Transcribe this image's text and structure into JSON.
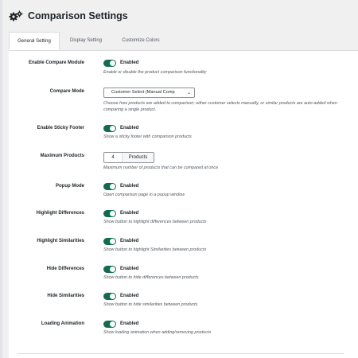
{
  "header": {
    "title": "Comparison Settings",
    "icon": "gears-icon"
  },
  "tabs": [
    {
      "label": "General Setting",
      "active": true
    },
    {
      "label": "Display Setting",
      "active": false
    },
    {
      "label": "Customize Colors",
      "active": false
    }
  ],
  "colors": {
    "toggle_on": "#0f6d4b",
    "page_bg": "#f0f0f1",
    "card_bg": "#ffffff"
  },
  "settings": {
    "compare_module": {
      "label": "Enable Compare Module",
      "state": "Enabled",
      "desc": "Enable or disable the product comparison functionality"
    },
    "compare_mode": {
      "label": "Compare Mode",
      "value": "Customer Select (Manual Comp",
      "desc": "Choose how products are added to comparison; either customer selects manually, or similar products are auto-added when comparing a single product."
    },
    "sticky_footer": {
      "label": "Enable Sticky Footer",
      "state": "Enabled",
      "desc": "Show a sticky footer with comparison products"
    },
    "max_products": {
      "label": "Maximum Products",
      "value": "4",
      "unit": "Products",
      "desc": "Maximum number of products that can be compared at once"
    },
    "popup_mode": {
      "label": "Popup Mode",
      "state": "Enabled",
      "desc": "Open comparison page in a popup window"
    },
    "highlight_differences": {
      "label": "Highlight Differences",
      "state": "Enabled",
      "desc": "Show button to highlight differences between products"
    },
    "highlight_similarities": {
      "label": "Highlight Similarities",
      "state": "Enabled",
      "desc": "Show button to highlight Similarities between products"
    },
    "hide_differences": {
      "label": "Hide Differences",
      "state": "Enabled",
      "desc": "Show button to hide differences between products"
    },
    "hide_similarities": {
      "label": "Hide Similarities",
      "state": "Enabled",
      "desc": "Show button to hide similarities between products"
    },
    "loading_animation": {
      "label": "Loading Animation",
      "state": "Enabled",
      "desc": "Show loading animation when adding/removing products"
    }
  }
}
